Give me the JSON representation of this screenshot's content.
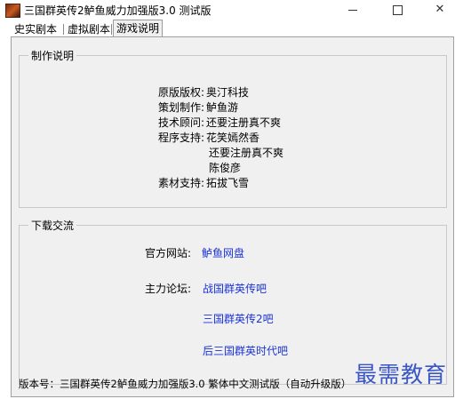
{
  "window": {
    "title": "三国群英传2鲈鱼威力加强版3.0 测试版",
    "minimize": "—",
    "maximize": "□",
    "close": "✕"
  },
  "tabs": [
    {
      "label": "史实剧本"
    },
    {
      "label": "虚拟剧本"
    },
    {
      "label": "游戏说明"
    }
  ],
  "credits": {
    "title": "制作说明",
    "rows": [
      {
        "label": "原版版权:",
        "value": "奥汀科技"
      },
      {
        "label": "策划制作:",
        "value": "鲈鱼游"
      },
      {
        "label": "技术顾问:",
        "value": "还要注册真不爽"
      },
      {
        "label": "程序支持:",
        "value": "花笑嫣然香"
      },
      {
        "label": "",
        "value": "还要注册真不爽"
      },
      {
        "label": "",
        "value": "陈俊彦"
      },
      {
        "label": "素材支持:",
        "value": "拓拔飞雪"
      }
    ]
  },
  "downloads": {
    "title": "下载交流",
    "official_label": "官方网站:",
    "official_link": "鲈鱼网盘",
    "forum_label": "主力论坛:",
    "forums": [
      "战国群英传吧",
      "三国群英传2吧",
      "后三国群英时代吧"
    ]
  },
  "version_text": "版本号：三国群英传2鲈鱼威力加强版3.0 繁体中文测试版（自动升级版）",
  "watermark": "最需教育",
  "colors": {
    "link": "#1b33d6",
    "panel": "#f0f0f0",
    "watermark": "#3a56c8"
  }
}
